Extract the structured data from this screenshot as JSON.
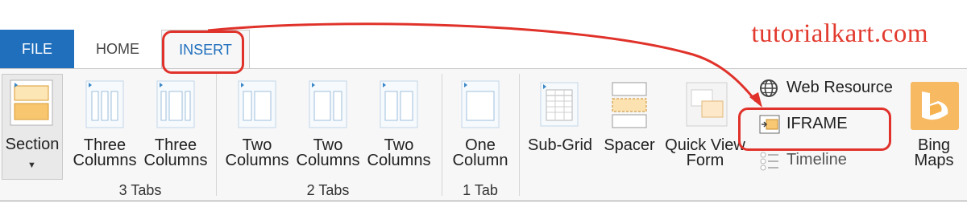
{
  "brand": "tutorialkart.com",
  "tabs": [
    {
      "label": "FILE"
    },
    {
      "label": "HOME"
    },
    {
      "label": "INSERT"
    }
  ],
  "ribbon": {
    "section": {
      "label": "Section"
    },
    "three_tabs": {
      "buttons": [
        {
          "line1": "Three",
          "line2": "Columns"
        },
        {
          "line1": "Three",
          "line2": "Columns"
        }
      ],
      "group_label": "3 Tabs"
    },
    "two_tabs": {
      "buttons": [
        {
          "line1": "Two",
          "line2": "Columns"
        },
        {
          "line1": "Two",
          "line2": "Columns"
        },
        {
          "line1": "Two",
          "line2": "Columns"
        }
      ],
      "group_label": "2 Tabs"
    },
    "one_tab": {
      "buttons": [
        {
          "line1": "One",
          "line2": "Column"
        }
      ],
      "group_label": "1 Tab"
    },
    "controls": {
      "subgrid": "Sub-Grid",
      "spacer": "Spacer",
      "quickview_line1": "Quick View",
      "quickview_line2": "Form",
      "web_resource": "Web Resource",
      "iframe": "IFRAME",
      "timeline": "Timeline",
      "bing_line1": "Bing",
      "bing_line2": "Maps"
    }
  },
  "colors": {
    "file_tab_bg": "#1f6fbd",
    "accent_blue": "#1f6fbd",
    "annotation_red": "#e0322a",
    "brand_red": "#e23a2e",
    "bing_orange": "#f4a12c"
  }
}
